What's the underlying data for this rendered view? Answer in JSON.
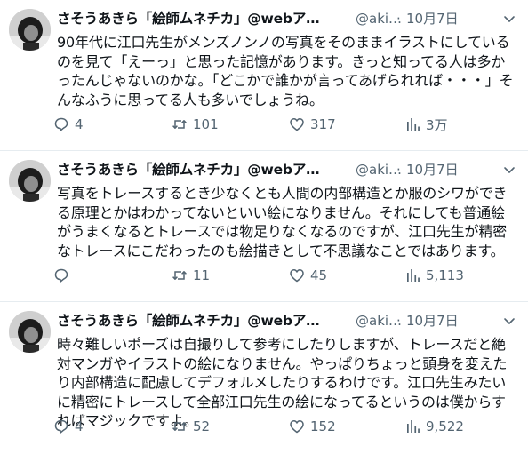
{
  "tweets": [
    {
      "name": "さそうあきら「絵師ムネチカ」@webア…",
      "handle": "@aki…",
      "separator": "·",
      "date": "10月7日",
      "text": "90年代に江口先生がメンズノンノの写真をそのままイラストにしているのを見て「えーっ」と思った記憶があります。きっと知ってる人は多かったんじゃないのかな。「どこかで誰かが言ってあげられれば・・・」そんなふうに思ってる人も多いでしょうね。",
      "replies": "4",
      "retweets": "101",
      "likes": "317",
      "views": "3万"
    },
    {
      "name": "さそうあきら「絵師ムネチカ」@webア…",
      "handle": "@aki…",
      "separator": "·",
      "date": "10月7日",
      "text": "写真をトレースするとき少なくとも人間の内部構造とか服のシワができる原理とかはわかってないといい絵になりません。それにしても普通絵がうまくなるとトレースでは物足りなくなるのですが、江口先生が精密なトレースにこだわったのも絵描きとして不思議なことではあります。",
      "replies": "",
      "retweets": "11",
      "likes": "45",
      "views": "5,113"
    },
    {
      "name": "さそうあきら「絵師ムネチカ」@webア…",
      "handle": "@aki…",
      "separator": "·",
      "date": "10月7日",
      "text": "時々難しいポーズは自撮りして参考にしたりしますが、トレースだと絶対マンガやイラストの絵になりません。やっぱりちょっと頭身を変えたり内部構造に配慮してデフォルメしたりするわけです。江口先生みたいに精密にトレースして全部江口先生の絵になってるというのは僕からすればマジックですよ。",
      "replies": "4",
      "retweets": "52",
      "likes": "152",
      "views": "9,522"
    }
  ],
  "icons": {
    "avatar": "avatar-photo",
    "more": "chevron-down-icon",
    "reply": "reply-icon",
    "retweet": "retweet-icon",
    "like": "heart-icon",
    "views": "views-icon"
  },
  "colors": {
    "text": "#0f1419",
    "secondary": "#536471",
    "divider": "#e6ecf0"
  }
}
